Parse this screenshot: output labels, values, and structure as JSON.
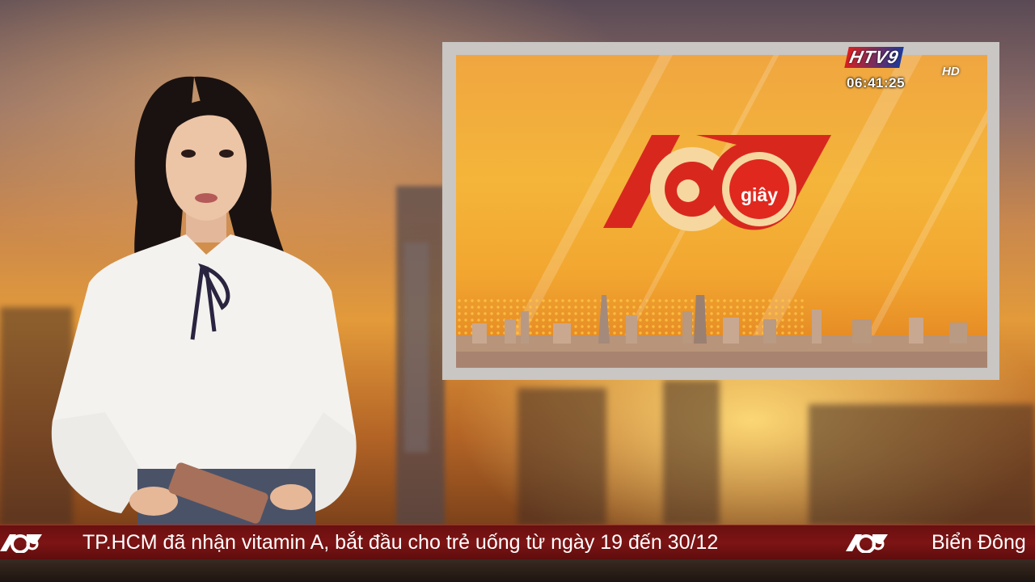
{
  "channel": {
    "name": "HTV9",
    "quality": "HD",
    "clock": "06:41:25"
  },
  "program": {
    "logo_number_icon": "sixty-logo-icon",
    "logo_word": "giây"
  },
  "ticker": {
    "headline": "TP.HCM đã nhận vitamin A, bắt đầu cho trẻ uống từ ngày 19 đến 30/12",
    "next_headline": "Biển Đông"
  },
  "colors": {
    "ticker_bg": "#7d1414",
    "logo_red": "#d8281e",
    "screen_orange": "#f2a630"
  }
}
